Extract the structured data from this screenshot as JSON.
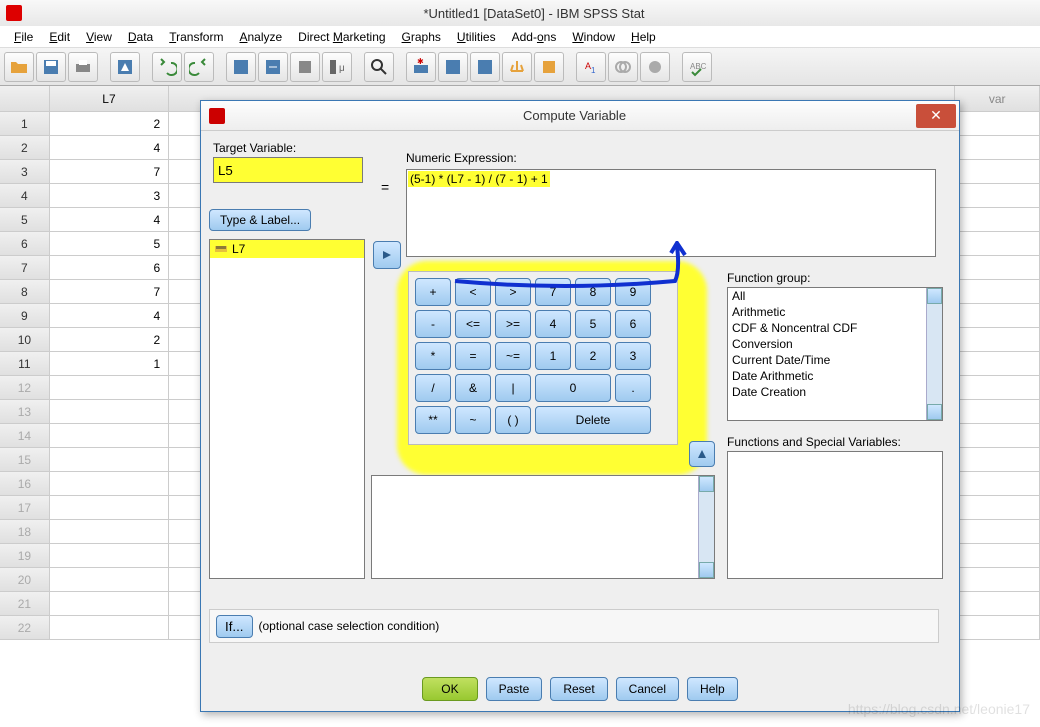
{
  "app": {
    "title": "*Untitled1 [DataSet0] - IBM SPSS Stat"
  },
  "menu": {
    "items": [
      "File",
      "Edit",
      "View",
      "Data",
      "Transform",
      "Analyze",
      "Direct Marketing",
      "Graphs",
      "Utilities",
      "Add-ons",
      "Window",
      "Help"
    ]
  },
  "grid": {
    "col_header": "L7",
    "var_header": "var",
    "rows": [
      {
        "n": "1",
        "v": "2"
      },
      {
        "n": "2",
        "v": "4"
      },
      {
        "n": "3",
        "v": "7"
      },
      {
        "n": "4",
        "v": "3"
      },
      {
        "n": "5",
        "v": "4"
      },
      {
        "n": "6",
        "v": "5"
      },
      {
        "n": "7",
        "v": "6"
      },
      {
        "n": "8",
        "v": "7"
      },
      {
        "n": "9",
        "v": "4"
      },
      {
        "n": "10",
        "v": "2"
      },
      {
        "n": "11",
        "v": "1"
      }
    ],
    "empty_rows": [
      "12",
      "13",
      "14",
      "15",
      "16",
      "17",
      "18",
      "19",
      "20",
      "21",
      "22"
    ]
  },
  "dialog": {
    "title": "Compute Variable",
    "target_label": "Target Variable:",
    "target_value": "L5",
    "numeric_label": "Numeric Expression:",
    "numeric_value": "(5-1) * (L7 - 1) / (7 - 1) + 1",
    "equals": "=",
    "type_label_btn": "Type & Label...",
    "var_item": "L7",
    "keypad": [
      [
        "+",
        "<",
        ">",
        "7",
        "8",
        "9"
      ],
      [
        "-",
        "<=",
        ">=",
        "4",
        "5",
        "6"
      ],
      [
        "*",
        "=",
        "~=",
        "1",
        "2",
        "3"
      ],
      [
        "/",
        "&",
        "|",
        "0",
        ".",
        ""
      ],
      [
        "**",
        "~",
        "( )",
        "Delete"
      ]
    ],
    "fg_label": "Function group:",
    "fg_items": [
      "All",
      "Arithmetic",
      "CDF & Noncentral CDF",
      "Conversion",
      "Current Date/Time",
      "Date Arithmetic",
      "Date Creation"
    ],
    "fs_label": "Functions and Special Variables:",
    "if_btn": "If...",
    "if_text": "(optional case selection condition)",
    "buttons": {
      "ok": "OK",
      "paste": "Paste",
      "reset": "Reset",
      "cancel": "Cancel",
      "help": "Help"
    }
  }
}
